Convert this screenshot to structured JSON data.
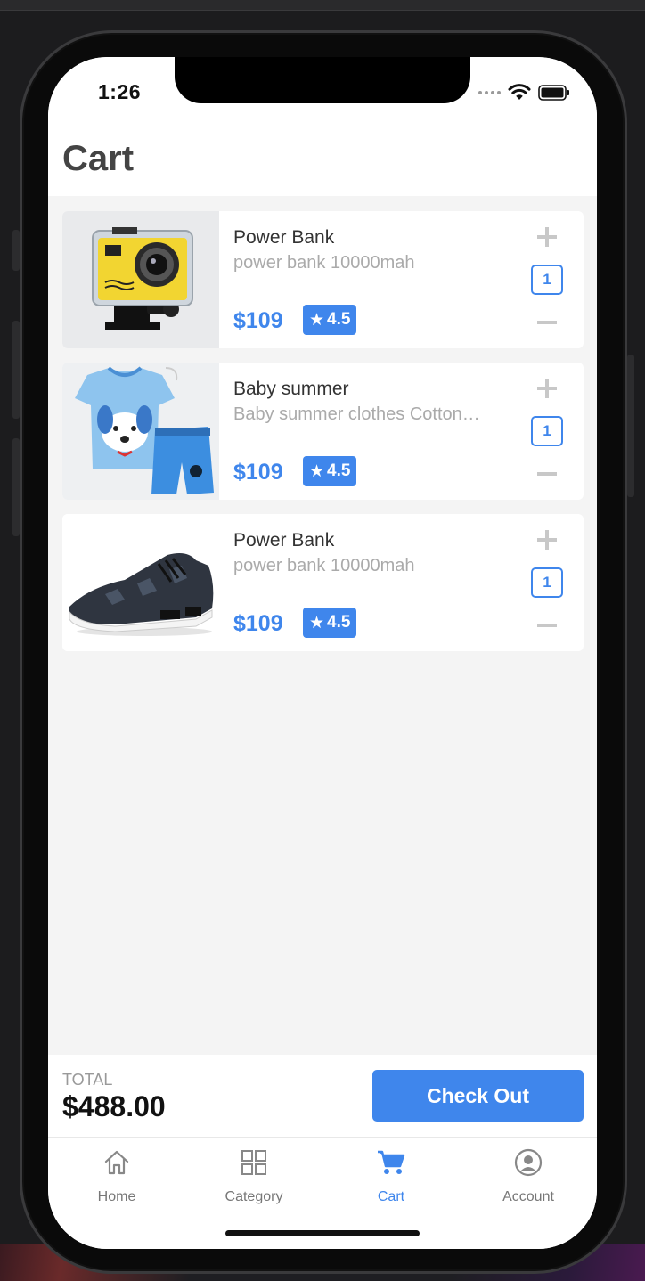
{
  "status": {
    "time": "1:26"
  },
  "header": {
    "title": "Cart"
  },
  "items": [
    {
      "name": "Power Bank",
      "description": "power bank 10000mah",
      "price": "$109",
      "rating": "4.5",
      "quantity": "1",
      "image": "action-camera"
    },
    {
      "name": "Baby summer",
      "description": "Baby summer clothes Cotton…",
      "price": "$109",
      "rating": "4.5",
      "quantity": "1",
      "image": "baby-clothes"
    },
    {
      "name": "Power Bank",
      "description": "power bank 10000mah",
      "price": "$109",
      "rating": "4.5",
      "quantity": "1",
      "image": "sneaker"
    }
  ],
  "footer": {
    "total_label": "TOTAL",
    "total_value": "$488.00",
    "checkout_label": "Check Out"
  },
  "tabs": [
    {
      "label": "Home",
      "icon": "home-icon",
      "active": false
    },
    {
      "label": "Category",
      "icon": "grid-icon",
      "active": false
    },
    {
      "label": "Cart",
      "icon": "cart-icon",
      "active": true
    },
    {
      "label": "Account",
      "icon": "account-icon",
      "active": false
    }
  ],
  "colors": {
    "accent": "#3f86ec",
    "title": "#444444",
    "background": "#f4f4f4"
  }
}
